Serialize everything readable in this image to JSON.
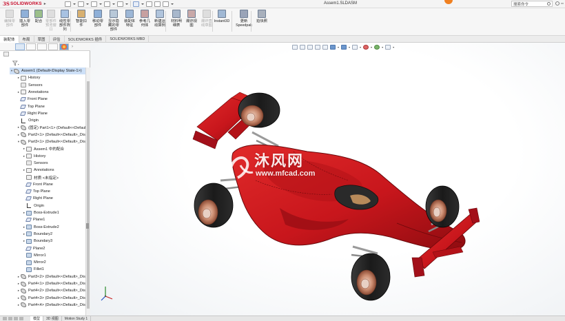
{
  "titlebar": {
    "brand_ds": "3S",
    "brand_name": "SOLIDWORKS",
    "document_title": "Assem1.SLDASM",
    "search_placeholder": "搜索命令"
  },
  "ribbon": {
    "buttons": [
      {
        "label": "编辑零部件",
        "enabled": false
      },
      {
        "label": "插入零部件",
        "enabled": true
      },
      {
        "label": "配合",
        "enabled": true
      },
      {
        "label": "零部件预览窗口",
        "enabled": false
      },
      {
        "label": "线性零部件阵列",
        "enabled": true
      },
      {
        "label": "智能扣件",
        "enabled": true
      },
      {
        "label": "移动零部件",
        "enabled": true
      },
      {
        "label": "显示隐藏的零部件",
        "enabled": true
      },
      {
        "label": "装配体特征",
        "enabled": true
      },
      {
        "label": "参考几何体",
        "enabled": true
      },
      {
        "label": "新建运动算例",
        "enabled": true
      },
      {
        "label": "材料明细表",
        "enabled": true
      },
      {
        "label": "爆炸视图",
        "enabled": true
      },
      {
        "label": "爆炸直线草图",
        "enabled": false
      },
      {
        "label": "Instant3D",
        "enabled": true
      },
      {
        "label": "更新Speedpak",
        "enabled": true
      },
      {
        "label": "拍快照",
        "enabled": true
      }
    ]
  },
  "command_tabs": [
    "装配体",
    "布局",
    "草图",
    "评估",
    "SOLIDWORKS 插件",
    "SOLIDWORKS MBD"
  ],
  "feature_tree": [
    {
      "label": "Assem1  (Default<Display State-1>)",
      "indent": 0,
      "icon": "assembly",
      "expander": "▾",
      "selected": true
    },
    {
      "label": "History",
      "indent": 1,
      "icon": "history",
      "expander": "▸"
    },
    {
      "label": "Sensors",
      "indent": 1,
      "icon": "sensor",
      "expander": ""
    },
    {
      "label": "Annotations",
      "indent": 1,
      "icon": "annotation",
      "expander": "▸"
    },
    {
      "label": "Front Plane",
      "indent": 1,
      "icon": "plane",
      "expander": ""
    },
    {
      "label": "Top Plane",
      "indent": 1,
      "icon": "plane",
      "expander": ""
    },
    {
      "label": "Right Plane",
      "indent": 1,
      "icon": "plane",
      "expander": ""
    },
    {
      "label": "Origin",
      "indent": 1,
      "icon": "origin",
      "expander": ""
    },
    {
      "label": "(固定) Part1<1> (Default<<Default>_Display S",
      "indent": 1,
      "icon": "part",
      "expander": "▸"
    },
    {
      "label": "Part2<1> (Default<<Default>_Display State",
      "indent": 1,
      "icon": "part",
      "expander": "▸"
    },
    {
      "label": "Part3<1> (Default<<Default>_Display State",
      "indent": 1,
      "icon": "part",
      "expander": "▾"
    },
    {
      "label": "Assem1 中的配合",
      "indent": 2,
      "icon": "mate",
      "expander": "▸"
    },
    {
      "label": "History",
      "indent": 2,
      "icon": "history",
      "expander": "▸"
    },
    {
      "label": "Sensors",
      "indent": 2,
      "icon": "sensor",
      "expander": ""
    },
    {
      "label": "Annotations",
      "indent": 2,
      "icon": "annotation",
      "expander": "▸"
    },
    {
      "label": "材质 <未指定>",
      "indent": 2,
      "icon": "material",
      "expander": ""
    },
    {
      "label": "Front Plane",
      "indent": 2,
      "icon": "plane",
      "expander": ""
    },
    {
      "label": "Top Plane",
      "indent": 2,
      "icon": "plane",
      "expander": ""
    },
    {
      "label": "Right Plane",
      "indent": 2,
      "icon": "plane",
      "expander": ""
    },
    {
      "label": "Origin",
      "indent": 2,
      "icon": "origin",
      "expander": ""
    },
    {
      "label": "Boss-Extrude1",
      "indent": 2,
      "icon": "feature",
      "expander": "▸"
    },
    {
      "label": "Plane1",
      "indent": 2,
      "icon": "plane",
      "expander": ""
    },
    {
      "label": "Boss-Extrude2",
      "indent": 2,
      "icon": "feature",
      "expander": "▸"
    },
    {
      "label": "Boundary2",
      "indent": 2,
      "icon": "feature",
      "expander": "▸"
    },
    {
      "label": "Boundary3",
      "indent": 2,
      "icon": "feature",
      "expander": "▸"
    },
    {
      "label": "Plane2",
      "indent": 2,
      "icon": "plane",
      "expander": ""
    },
    {
      "label": "Mirror1",
      "indent": 2,
      "icon": "feature",
      "expander": ""
    },
    {
      "label": "Mirror2",
      "indent": 2,
      "icon": "feature",
      "expander": ""
    },
    {
      "label": "Fillet1",
      "indent": 2,
      "icon": "feature",
      "expander": ""
    },
    {
      "label": "Part3<2> (Default<<Default>_Display State",
      "indent": 1,
      "icon": "part",
      "expander": "▸"
    },
    {
      "label": "Part4<1> (Default<<Default>_Display State",
      "indent": 1,
      "icon": "part",
      "expander": "▸"
    },
    {
      "label": "Part4<2> (Default<<Default>_Display State",
      "indent": 1,
      "icon": "part",
      "expander": "▸"
    },
    {
      "label": "Part4<3> (Default<<Default>_Display State",
      "indent": 1,
      "icon": "part",
      "expander": "▸"
    },
    {
      "label": "Part4<4> (Default<<Default>_Display State",
      "indent": 1,
      "icon": "part",
      "expander": "▸"
    }
  ],
  "watermark": {
    "chinese": "沐风网",
    "url": "www.mfcad.com"
  },
  "bottom_tabs": [
    "模型",
    "3D 视图",
    "Motion Study 1"
  ],
  "colors": {
    "brand_red": "#c8102e",
    "car_body": "#c8161c",
    "tire": "#1c1c1c",
    "brake": "#c98a6e",
    "selection": "#cde0f7"
  }
}
